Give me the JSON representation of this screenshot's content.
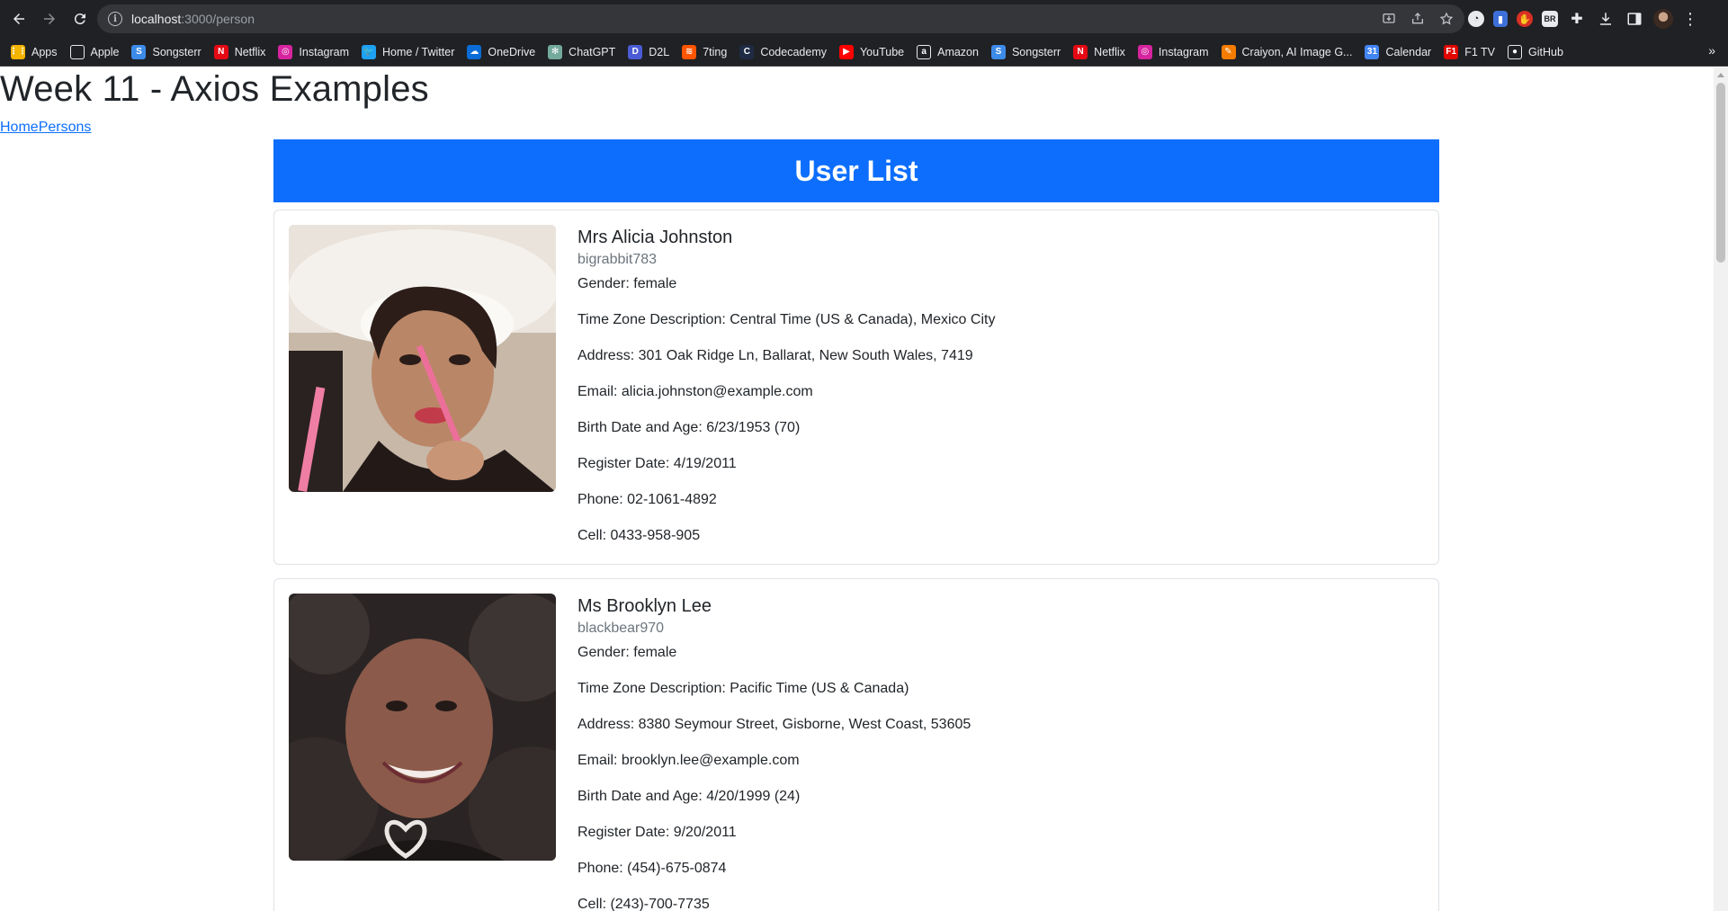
{
  "browser": {
    "url_host": "localhost",
    "url_path": ":3000/person"
  },
  "bookmarks": [
    {
      "label": "Apps",
      "icon": "apps-grid-icon",
      "color": "#f4b400"
    },
    {
      "label": "Apple",
      "icon": "apple-icon",
      "color": "#ffffff"
    },
    {
      "label": "Songsterr",
      "icon": "songsterr-icon",
      "color": "#3d8be8"
    },
    {
      "label": "Netflix",
      "icon": "netflix-icon",
      "color": "#e50914"
    },
    {
      "label": "Instagram",
      "icon": "instagram-icon",
      "color": "#d6249f"
    },
    {
      "label": "Home / Twitter",
      "icon": "twitter-icon",
      "color": "#1da1f2"
    },
    {
      "label": "OneDrive",
      "icon": "onedrive-icon",
      "color": "#0a6cd6"
    },
    {
      "label": "ChatGPT",
      "icon": "chatgpt-icon",
      "color": "#74aa9c"
    },
    {
      "label": "D2L",
      "icon": "d2l-icon",
      "color": "#4a5bd4"
    },
    {
      "label": "7ting",
      "icon": "soundcloud-icon",
      "color": "#ff5500"
    },
    {
      "label": "Codecademy",
      "icon": "codecademy-icon",
      "color": "#1f2a44"
    },
    {
      "label": "YouTube",
      "icon": "youtube-icon",
      "color": "#ff0000"
    },
    {
      "label": "Amazon",
      "icon": "amazon-icon",
      "color": "#ffffff"
    },
    {
      "label": "Songsterr",
      "icon": "songsterr-icon",
      "color": "#3d8be8"
    },
    {
      "label": "Netflix",
      "icon": "netflix-icon",
      "color": "#e50914"
    },
    {
      "label": "Instagram",
      "icon": "instagram-icon",
      "color": "#d6249f"
    },
    {
      "label": "Craiyon, AI Image G...",
      "icon": "craiyon-icon",
      "color": "#f57c00"
    },
    {
      "label": "Calendar",
      "icon": "calendar-icon",
      "color": "#4285f4"
    },
    {
      "label": "F1 TV",
      "icon": "f1-icon",
      "color": "#e10600"
    },
    {
      "label": "GitHub",
      "icon": "github-icon",
      "color": "#ffffff"
    }
  ],
  "page": {
    "title": "Week 11 - Axios Examples",
    "nav_home": "Home",
    "nav_persons": "Persons",
    "banner": "User List"
  },
  "users": [
    {
      "name": "Mrs Alicia Johnston",
      "username": "bigrabbit783",
      "gender": "Gender: female",
      "timezone": "Time Zone Description: Central Time (US & Canada), Mexico City",
      "address": "Address: 301 Oak Ridge Ln, Ballarat, New South Wales, 7419",
      "email": "Email: alicia.johnston@example.com",
      "birth": "Birth Date and Age: 6/23/1953 (70)",
      "register": "Register Date: 4/19/2011",
      "phone": "Phone: 02-1061-4892",
      "cell": "Cell: 0433-958-905"
    },
    {
      "name": "Ms Brooklyn Lee",
      "username": "blackbear970",
      "gender": "Gender: female",
      "timezone": "Time Zone Description: Pacific Time (US & Canada)",
      "address": "Address: 8380 Seymour Street, Gisborne, West Coast, 53605",
      "email": "Email: brooklyn.lee@example.com",
      "birth": "Birth Date and Age: 4/20/1999 (24)",
      "register": "Register Date: 9/20/2011",
      "phone": "Phone: (454)-675-0874",
      "cell": "Cell: (243)-700-7735"
    }
  ],
  "colors": {
    "banner": "#0d6efd",
    "link": "#0d6efd",
    "chrome": "#202124"
  }
}
